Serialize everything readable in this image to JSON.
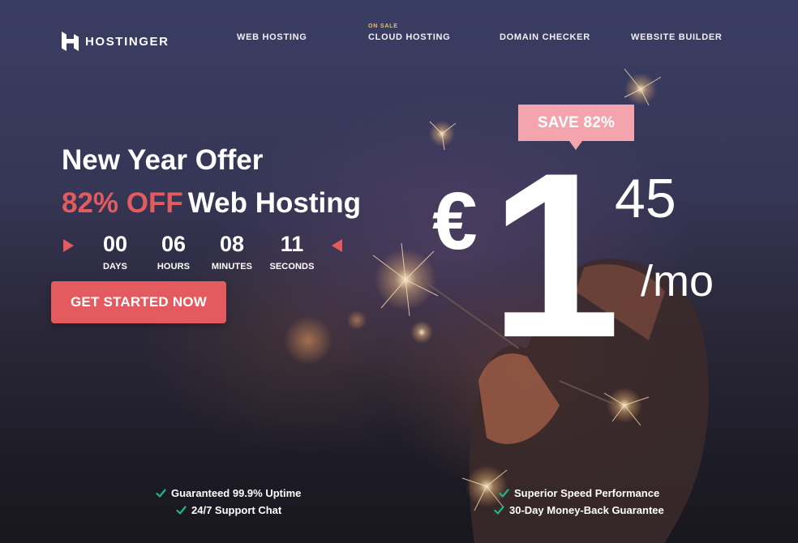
{
  "header": {
    "brand": "HOSTINGER",
    "nav": [
      {
        "label": "WEB HOSTING",
        "badge": ""
      },
      {
        "label": "CLOUD HOSTING",
        "badge": "ON SALE"
      },
      {
        "label": "DOMAIN CHECKER",
        "badge": ""
      },
      {
        "label": "WEBSITE BUILDER",
        "badge": ""
      }
    ]
  },
  "hero": {
    "headline": "New Year Offer",
    "discount": "82% OFF",
    "product": "Web Hosting",
    "countdown": [
      {
        "value": "00",
        "label": "DAYS"
      },
      {
        "value": "06",
        "label": "HOURS"
      },
      {
        "value": "08",
        "label": "MINUTES"
      },
      {
        "value": "11",
        "label": "SECONDS"
      }
    ],
    "cta_label": "GET STARTED NOW"
  },
  "price": {
    "save_badge": "SAVE 82%",
    "currency": "€",
    "whole": "1",
    "cents": "45",
    "period": "/mo"
  },
  "features": [
    "Guaranteed 99.9% Uptime",
    "24/7 Support Chat",
    "Superior Speed Performance",
    "30-Day Money-Back Guarantee"
  ],
  "colors": {
    "accent": "#e35b5f",
    "badge": "#f4a4ad",
    "sale_tag": "#f6c343",
    "check": "#1fb58a",
    "background": "#363656"
  },
  "icons": {
    "logo": "hostinger-logo-icon",
    "arrow_left": "triangle-right-icon",
    "arrow_right": "triangle-left-icon",
    "feature": "check-icon"
  }
}
